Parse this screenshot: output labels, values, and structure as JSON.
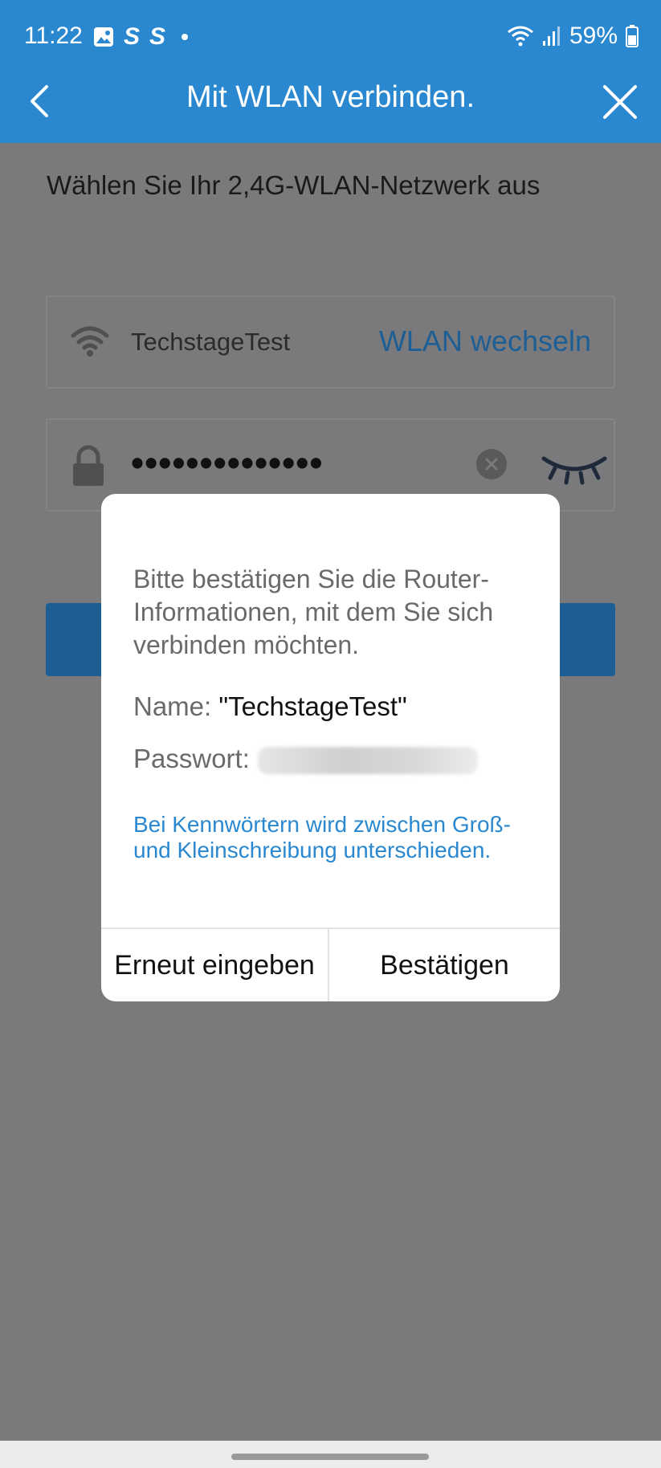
{
  "status_bar": {
    "time": "11:22",
    "battery": "59%",
    "icons_left": [
      "gallery-icon",
      "s-app-icon",
      "s-app-icon",
      "dot-icon"
    ],
    "app_glyphs": [
      "S",
      "S"
    ],
    "icons_right": [
      "wifi-icon",
      "signal-icon",
      "battery-icon"
    ]
  },
  "app_bar": {
    "title": "Mit WLAN verbinden."
  },
  "main": {
    "instruction": "Wählen Sie Ihr 2,4G-WLAN-Netzwerk aus",
    "ssid": "TechstageTest",
    "switch_wifi_label": "WLAN wechseln",
    "password_masked": "••••••••••••••"
  },
  "dialog": {
    "message": "Bitte bestätigen Sie die Router-Informationen, mit dem Sie sich verbinden möchten.",
    "name_label": "Name:",
    "name_value": "\"TechstageTest\"",
    "password_label": "Passwort:",
    "note": "Bei Kennwörtern wird zwischen Groß- und Kleinschreibung unterschieden.",
    "reenter_label": "Erneut eingeben",
    "confirm_label": "Bestätigen"
  },
  "colors": {
    "primary": "#2a88d0",
    "primary_dark": "#1d5e94",
    "overlay_bg": "#7a7a7c"
  }
}
